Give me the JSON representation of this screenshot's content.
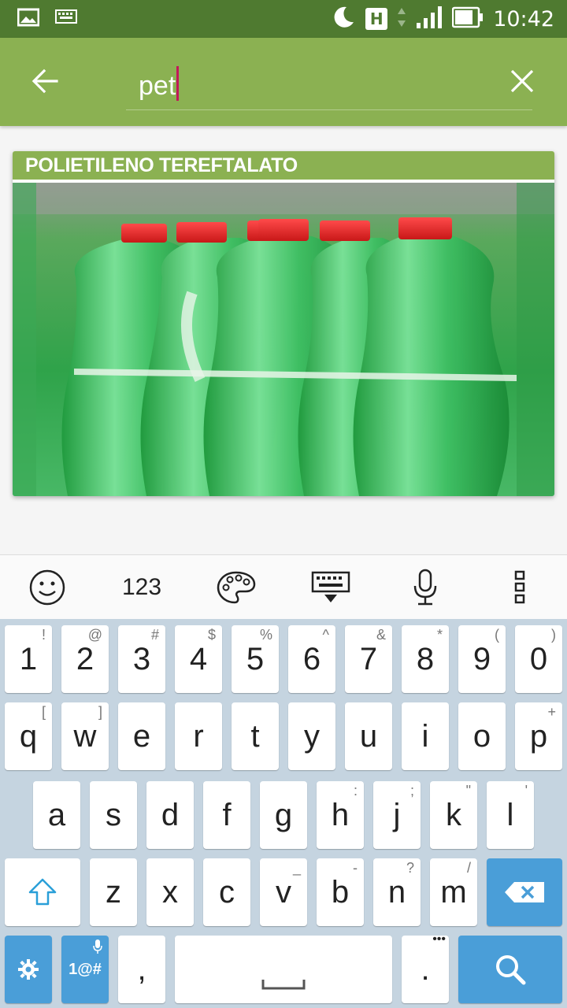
{
  "status_bar": {
    "time": "10:42",
    "network_badge": "H",
    "icons": [
      "gallery-icon",
      "keyboard-icon",
      "moon-icon",
      "network-icon",
      "signal-icon",
      "battery-icon"
    ]
  },
  "search": {
    "query": "pet"
  },
  "results": [
    {
      "title": "POLIETILENO TEREFTALATO",
      "image": "green-plastic-bottles"
    }
  ],
  "keyboard_toolbar": {
    "numbers_label": "123",
    "icons": [
      "emoji-icon",
      "palette-icon",
      "keyboard-hide-icon",
      "mic-icon",
      "more-vert-icon"
    ]
  },
  "keyboard": {
    "row1": [
      {
        "k": "1",
        "h": "!"
      },
      {
        "k": "2",
        "h": "@"
      },
      {
        "k": "3",
        "h": "#"
      },
      {
        "k": "4",
        "h": "$"
      },
      {
        "k": "5",
        "h": "%"
      },
      {
        "k": "6",
        "h": "^"
      },
      {
        "k": "7",
        "h": "&"
      },
      {
        "k": "8",
        "h": "*"
      },
      {
        "k": "9",
        "h": "("
      },
      {
        "k": "0",
        "h": ")"
      }
    ],
    "row2": [
      {
        "k": "q",
        "h": "["
      },
      {
        "k": "w",
        "h": "]"
      },
      {
        "k": "e",
        "h": ""
      },
      {
        "k": "r",
        "h": ""
      },
      {
        "k": "t",
        "h": ""
      },
      {
        "k": "y",
        "h": ""
      },
      {
        "k": "u",
        "h": ""
      },
      {
        "k": "i",
        "h": ""
      },
      {
        "k": "o",
        "h": ""
      },
      {
        "k": "p",
        "h": "+"
      }
    ],
    "row3": [
      {
        "k": "a",
        "h": ""
      },
      {
        "k": "s",
        "h": ""
      },
      {
        "k": "d",
        "h": ""
      },
      {
        "k": "f",
        "h": ""
      },
      {
        "k": "g",
        "h": ""
      },
      {
        "k": "h",
        "h": ":"
      },
      {
        "k": "j",
        "h": ";"
      },
      {
        "k": "k",
        "h": "\""
      },
      {
        "k": "l",
        "h": "'"
      }
    ],
    "row4": [
      {
        "k": "z",
        "h": ""
      },
      {
        "k": "x",
        "h": ""
      },
      {
        "k": "c",
        "h": ""
      },
      {
        "k": "v",
        "h": "_"
      },
      {
        "k": "b",
        "h": "-"
      },
      {
        "k": "n",
        "h": "?"
      },
      {
        "k": "m",
        "h": "/"
      }
    ],
    "symbols_label": "1@#",
    "comma": ",",
    "period": ".",
    "period_hint": "•••"
  }
}
